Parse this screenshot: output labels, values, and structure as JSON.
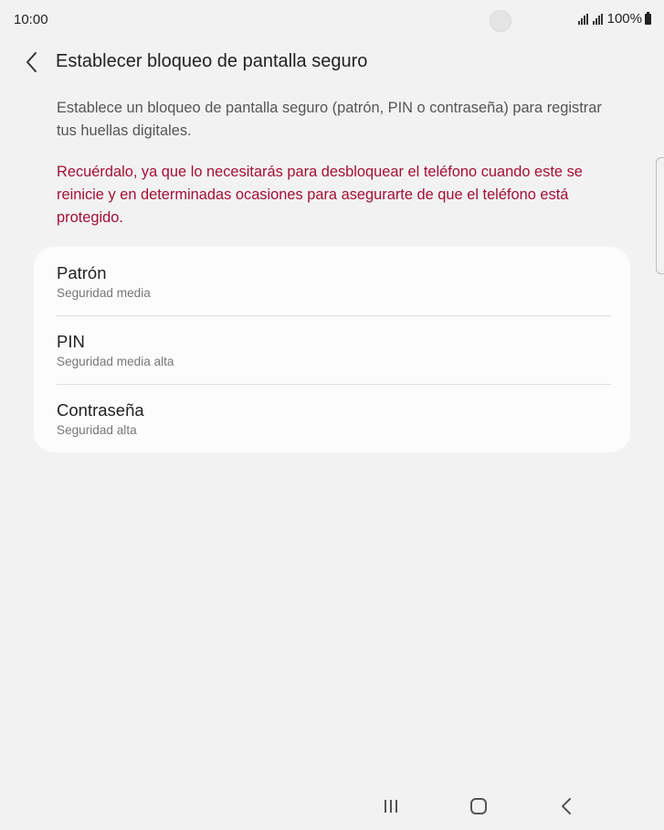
{
  "status_bar": {
    "time": "10:00",
    "battery": "100%"
  },
  "header": {
    "title": "Establecer bloqueo de pantalla seguro"
  },
  "content": {
    "intro": "Establece un bloqueo de pantalla seguro (patrón, PIN o contraseña) para registrar tus huellas digitales.",
    "warning": "Recuérdalo, ya que lo necesitarás para desbloquear el teléfono cuando este se reinicie y en determinadas ocasiones para asegurarte de que el teléfono está protegido."
  },
  "options": [
    {
      "title": "Patrón",
      "subtitle": "Seguridad media"
    },
    {
      "title": "PIN",
      "subtitle": "Seguridad media alta"
    },
    {
      "title": "Contraseña",
      "subtitle": "Seguridad alta"
    }
  ],
  "colors": {
    "background": "#f2f2f2",
    "card": "#fcfcfc",
    "warning_text": "#a31035",
    "body_text": "#555555"
  },
  "icons": {
    "back": "chevron-left-icon",
    "signal": "signal-icon",
    "battery": "battery-icon",
    "nav_recent": "recent-apps-icon",
    "nav_home": "home-icon",
    "nav_back": "back-icon"
  }
}
